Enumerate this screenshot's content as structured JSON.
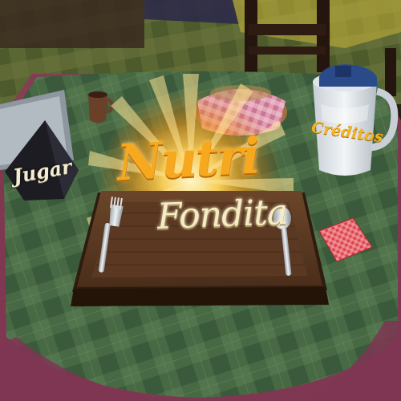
{
  "game": {
    "logo_line1": "Nutri",
    "logo_line2": "Fondita"
  },
  "menu": {
    "play_label": "Jugar",
    "credits_label": "Créditos"
  },
  "colors": {
    "logo_orange": "#f6a81e",
    "logo_cream": "#f6ecc4",
    "tablecloth_green": "#3f6340",
    "tray_wood": "#5a3922",
    "napkin_red": "#e0484c"
  },
  "icons": {
    "fork": "fork-icon",
    "spoon": "spoon-icon",
    "play_stand": "napkin-holder-icon",
    "credits_prop": "pitcher-icon"
  }
}
